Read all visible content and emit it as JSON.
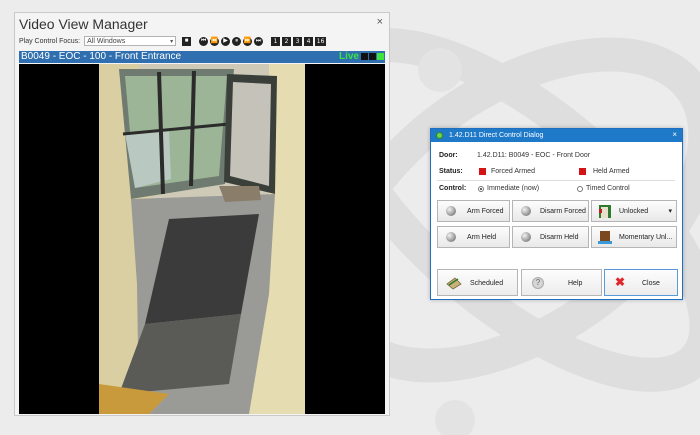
{
  "video_view_manager": {
    "title": "Video View Manager",
    "close": "×",
    "play_control_focus_label": "Play Control Focus:",
    "play_control_focus_value": "All Windows",
    "number_buttons": [
      "1",
      "2",
      "3",
      "4",
      "16"
    ],
    "camera": {
      "title": "B0049 - EOC - 100 - Front Entrance",
      "live_label": "Live"
    }
  },
  "dialog": {
    "title": "1.42.D11 Direct Control Dialog",
    "close": "×",
    "door_label": "Door:",
    "door_value": "1.42.D11: B0049 - EOC - Front Door",
    "status_label": "Status:",
    "status_forced": "Forced Armed",
    "status_held": "Held Armed",
    "control_label": "Control:",
    "control_immediate": "Immediate (now)",
    "control_timed": "Timed Control",
    "control_selected": "Immediate (now)",
    "buttons": {
      "arm_forced": "Arm Forced",
      "disarm_forced": "Disarm Forced",
      "unlocked": "Unlocked",
      "arm_held": "Arm Held",
      "disarm_held": "Disarm Held",
      "momentary_unlock": "Momentary Unl...",
      "scheduled": "Scheduled",
      "help": "Help",
      "close": "Close"
    }
  },
  "colors": {
    "camera_bar": "#2f6fb0",
    "live_green": "#3ee33e",
    "dialog_titlebar": "#1f79c9",
    "status_red": "#d41414"
  }
}
